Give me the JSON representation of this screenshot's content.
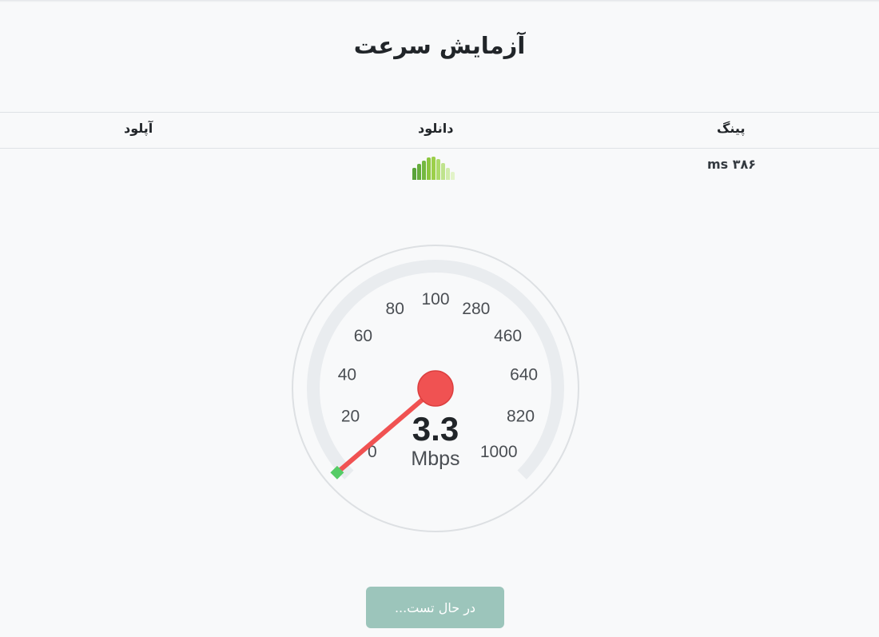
{
  "page": {
    "title": "آزمایش سرعت"
  },
  "stats": {
    "ping_label": "پینگ",
    "download_label": "دانلود",
    "upload_label": "آپلود",
    "ping_value": "ms ۳۸۶",
    "download_value": "",
    "upload_value": ""
  },
  "download_activity": {
    "levels": [
      0.5,
      0.68,
      0.82,
      0.95,
      1.0,
      0.88,
      0.72,
      0.52,
      0.35
    ],
    "colors": [
      "#5aa43a",
      "#66ad3c",
      "#73b83f",
      "#8cc63f",
      "#9ccf4a",
      "#addb6a",
      "#bfe38c",
      "#d1ecaa",
      "#e2f3c8"
    ]
  },
  "gauge": {
    "ticks": [
      "0",
      "20",
      "40",
      "60",
      "80",
      "100",
      "280",
      "460",
      "640",
      "820",
      "1000"
    ],
    "value": "3.3",
    "unit": "Mbps",
    "colors": {
      "track": "#e9ecef",
      "needle": "#f05252",
      "hub": "#f05252",
      "progress": "#55cc66"
    }
  },
  "status_button": {
    "label": "در حال تست..."
  }
}
